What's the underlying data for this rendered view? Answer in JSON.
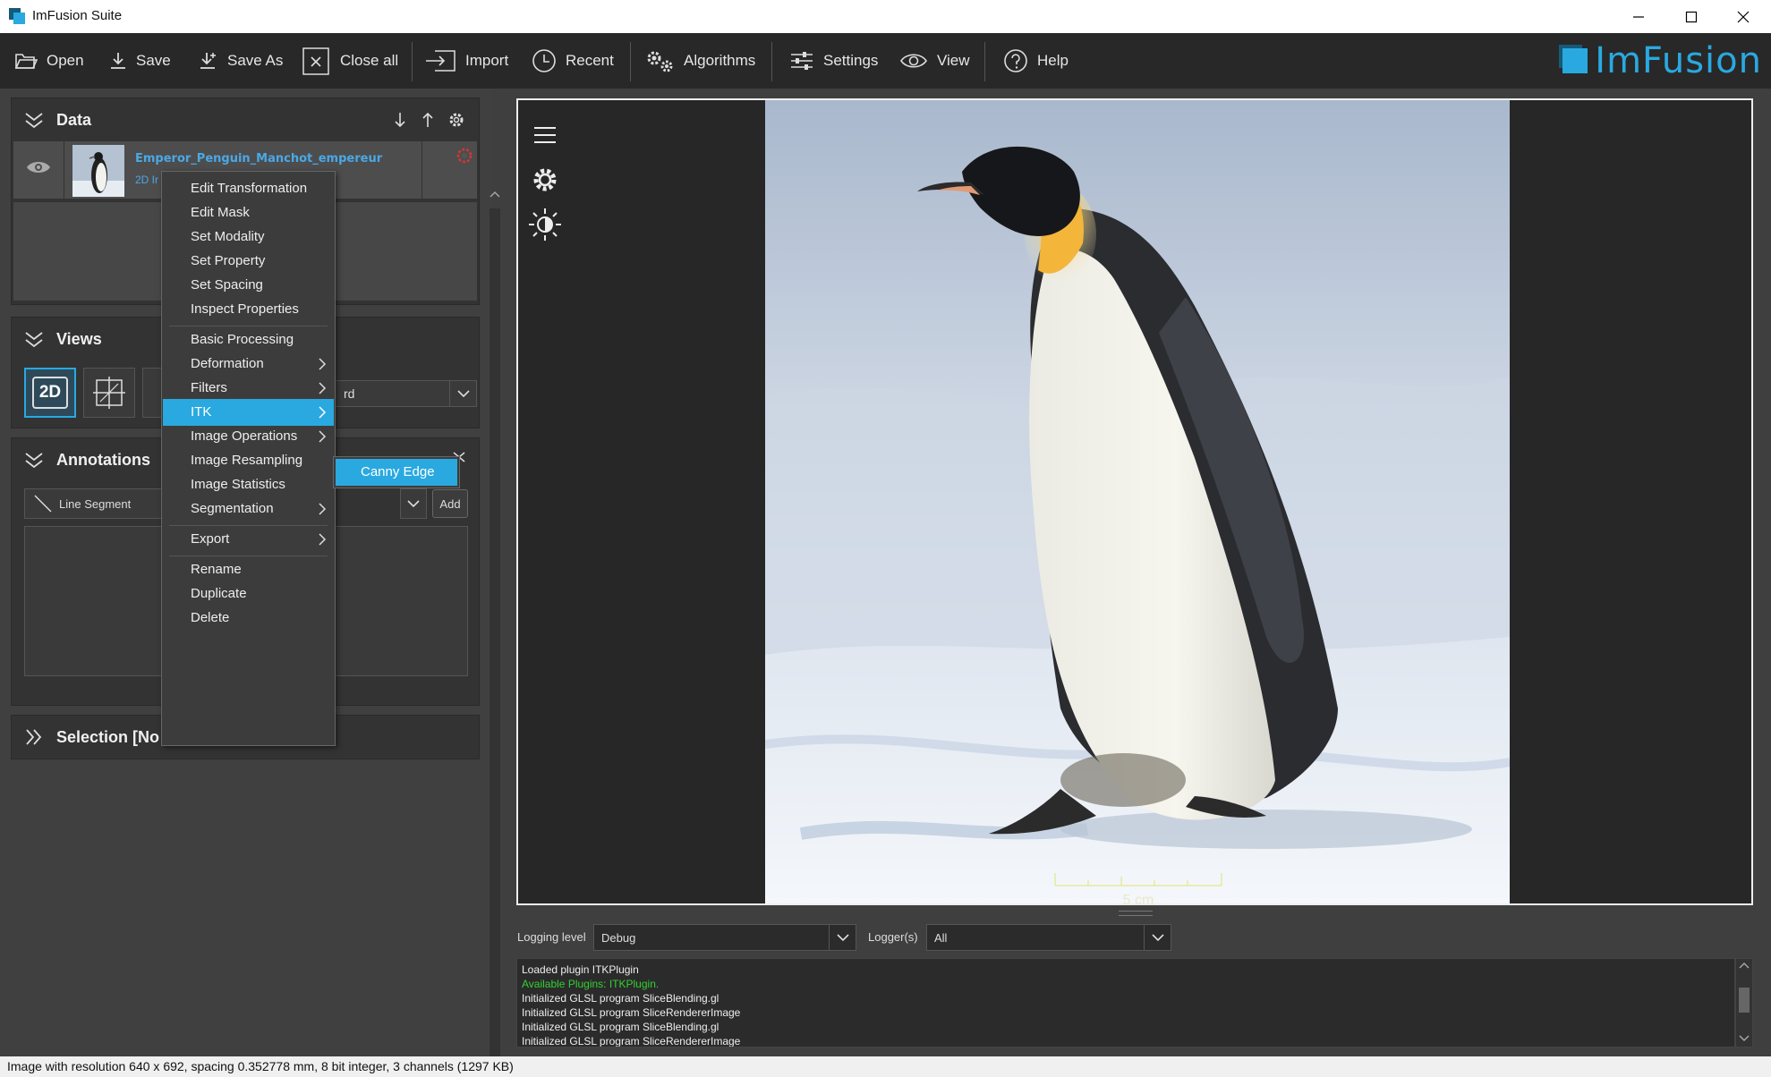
{
  "window": {
    "title": "ImFusion Suite"
  },
  "toolbar": {
    "open": "Open",
    "save": "Save",
    "save_as": "Save As",
    "close_all": "Close all",
    "import": "Import",
    "recent": "Recent",
    "algorithms": "Algorithms",
    "settings": "Settings",
    "view": "View",
    "help": "Help",
    "logo": "ImFusion"
  },
  "data_panel": {
    "title": "Data",
    "item_name": "Emperor_Penguin_Manchot_empereur",
    "item_sub": "2D Ir"
  },
  "views_panel": {
    "title": "Views",
    "btn_2d": "2D",
    "select_value": "rd"
  },
  "annotations_panel": {
    "title": "Annotations",
    "type": "Line Segment",
    "add": "Add"
  },
  "selection_panel": {
    "title": "Selection [No"
  },
  "context_menu": {
    "items": [
      "Edit Transformation",
      "Edit Mask",
      "Set Modality",
      "Set Property",
      "Set Spacing",
      "Inspect Properties",
      "Basic Processing",
      "Deformation",
      "Filters",
      "ITK",
      "Image Operations",
      "Image Resampling",
      "Image Statistics",
      "Segmentation",
      "Export",
      "Rename",
      "Duplicate",
      "Delete"
    ],
    "active": "ITK",
    "submenu": [
      "Canny Edge"
    ]
  },
  "viewport": {
    "scale_label": "5 cm"
  },
  "logging": {
    "level_label": "Logging level",
    "level_value": "Debug",
    "loggers_label": "Logger(s)",
    "loggers_value": "All",
    "lines": [
      "Loaded plugin ITKPlugin",
      "Available Plugins: ITKPlugin.",
      "Initialized GLSL program SliceBlending.gl",
      "Initialized GLSL program SliceRendererImage",
      "Initialized GLSL program SliceBlending.gl",
      "Initialized GLSL program SliceRendererImage"
    ]
  },
  "status": "Image with resolution 640 x 692, spacing 0.352778 mm, 8 bit integer, 3 channels (1297 KB)",
  "colors": {
    "accent": "#29a9e0",
    "log_green": "#32d032"
  }
}
